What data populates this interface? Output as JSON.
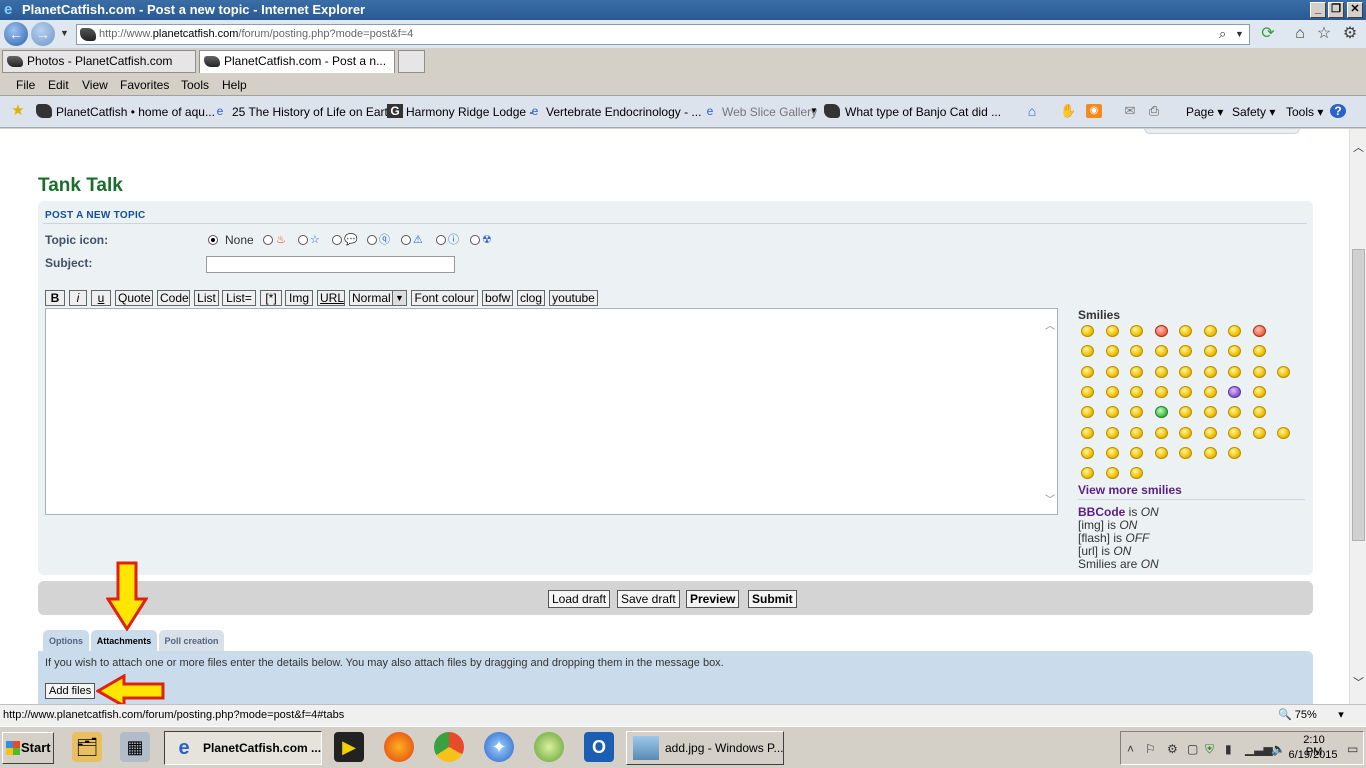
{
  "window": {
    "title": "PlanetCatfish.com - Post a new topic - Internet Explorer",
    "minimize": "_",
    "restore": "❐",
    "close": "✕"
  },
  "navigation": {
    "url_prefix": "http://www.",
    "url_host": "planetcatfish.com",
    "url_path": "/forum/posting.php?mode=post&f=4"
  },
  "browser_tabs": [
    {
      "label": "Photos - PlanetCatfish.com",
      "active": false
    },
    {
      "label": "PlanetCatfish.com - Post a n...",
      "active": true
    }
  ],
  "menubar": [
    "File",
    "Edit",
    "View",
    "Favorites",
    "Tools",
    "Help"
  ],
  "favorites": [
    {
      "label": "PlanetCatfish • home of aqu..."
    },
    {
      "label": "25 The History of Life on Earth"
    },
    {
      "label": "Harmony Ridge Lodge -"
    },
    {
      "label": "Vertebrate Endocrinology - ..."
    },
    {
      "label": "Web Slice Gallery"
    },
    {
      "label": "What type of Banjo Cat did ..."
    }
  ],
  "commandbar": {
    "page": "Page",
    "safety": "Safety",
    "tools": "Tools"
  },
  "forum": {
    "title": "Tank Talk",
    "section_heading": "POST A NEW TOPIC",
    "topic_icon_label": "Topic icon:",
    "topic_icon_none": "None",
    "subject_label": "Subject:",
    "subject_value": ""
  },
  "format_buttons": [
    "B",
    "i",
    "u",
    "Quote",
    "Code",
    "List",
    "List=",
    "[*]",
    "Img",
    "URL",
    "Normal",
    "Font colour",
    "bofw",
    "clog",
    "youtube"
  ],
  "message_value": "",
  "smilies": {
    "title": "Smilies",
    "view_more": "View more smilies"
  },
  "status": {
    "bbcode_link": "BBCode",
    "bbcode_is": " is ",
    "bbcode_state": "ON",
    "img": "[img] is ",
    "img_state": "ON",
    "flash": "[flash] is ",
    "flash_state": "OFF",
    "url": "[url] is ",
    "url_state": "ON",
    "smilies": "Smilies are ",
    "smilies_state": "ON"
  },
  "submit_buttons": {
    "load_draft": "Load draft",
    "save_draft": "Save draft",
    "preview": "Preview",
    "submit": "Submit"
  },
  "panel_tabs": {
    "options": "Options",
    "attachments": "Attachments",
    "poll": "Poll creation"
  },
  "attachments": {
    "instructions": "If you wish to attach one or more files enter the details below. You may also attach files by dragging and dropping them in the message box.",
    "add_files": "Add files"
  },
  "statusbar": {
    "url": "http://www.planetcatfish.com/forum/posting.php?mode=post&f=4#tabs",
    "zoom": "75%"
  },
  "taskbar": {
    "start": "Start",
    "tasks": [
      {
        "label": "PlanetCatfish.com ...",
        "active": true
      },
      {
        "label": "add.jpg - Windows P...",
        "active": false
      }
    ],
    "time": "2:10 PM",
    "date": "6/19/2015"
  },
  "colors": {
    "forum_title": "#1a6e2b",
    "panel_bg": "#ecf1f3",
    "annotation_arrow": "#ffe600"
  }
}
